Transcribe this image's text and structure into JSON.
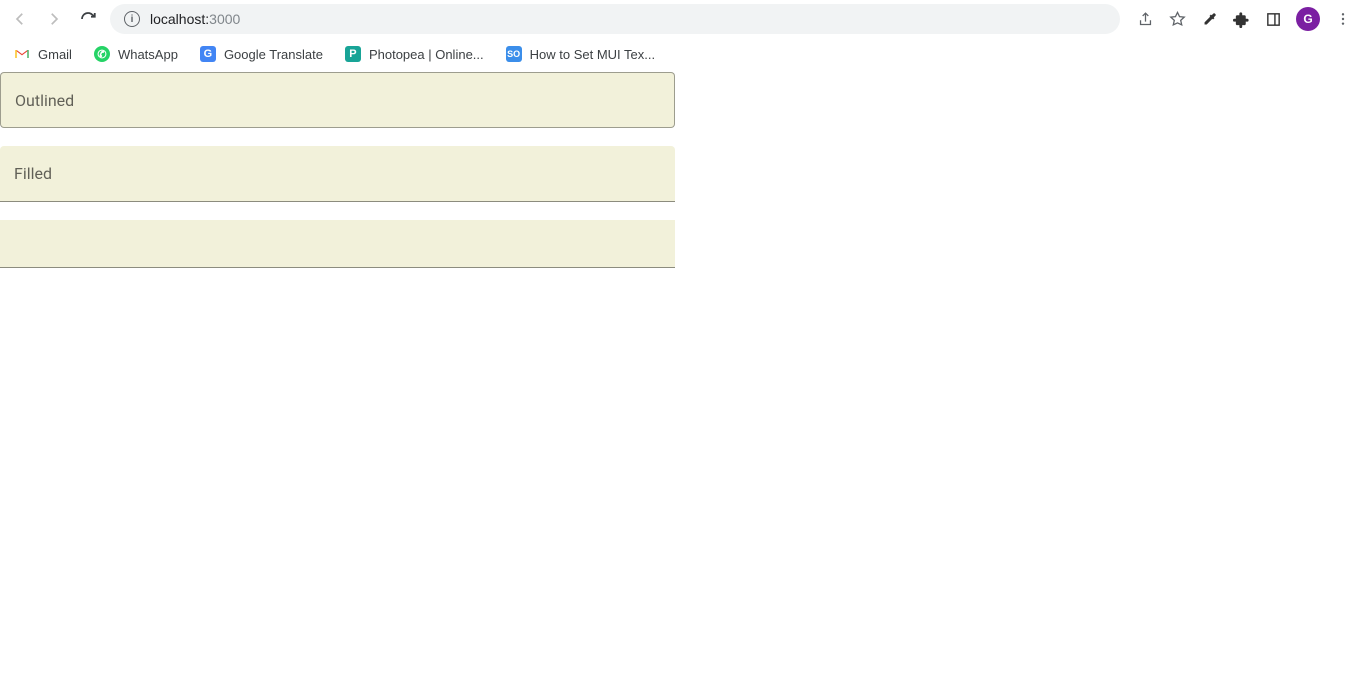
{
  "browser": {
    "url_host": "localhost:",
    "url_port": "3000",
    "profile_letter": "G"
  },
  "bookmarks": [
    {
      "label": "Gmail"
    },
    {
      "label": "WhatsApp"
    },
    {
      "label": "Google Translate"
    },
    {
      "label": "Photopea | Online..."
    },
    {
      "label": "How to Set MUI Tex..."
    }
  ],
  "fields": {
    "outlined_label": "Outlined",
    "filled_label": "Filled",
    "standard_label": ""
  }
}
